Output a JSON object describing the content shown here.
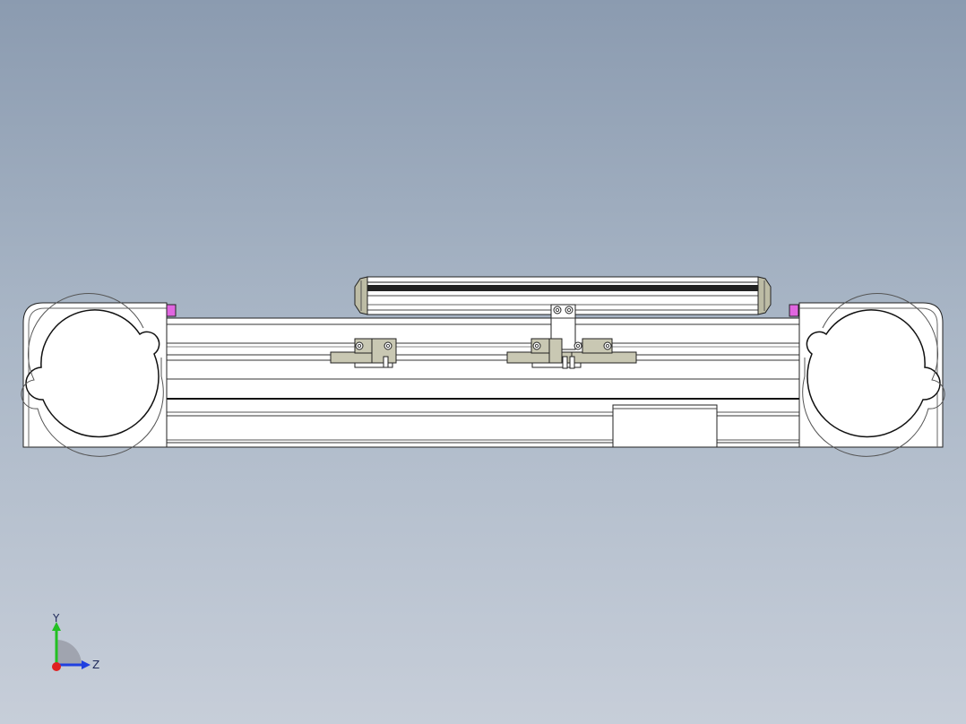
{
  "viewport": {
    "background_top": "#8b9bb0",
    "background_bottom": "#c7ced9"
  },
  "model": {
    "body_color": "#ffffff",
    "line_color": "#222222",
    "carriage_color": "#c9c8b3",
    "cylinder_cap_color": "#bdbca5",
    "end_stop_color": "#e066e0",
    "rail_color": "#f4f4f4"
  },
  "triad": {
    "y_label": "Y",
    "z_label": "Z",
    "y_color": "#22c022",
    "z_color": "#2040e0",
    "x_color": "#e02020"
  }
}
